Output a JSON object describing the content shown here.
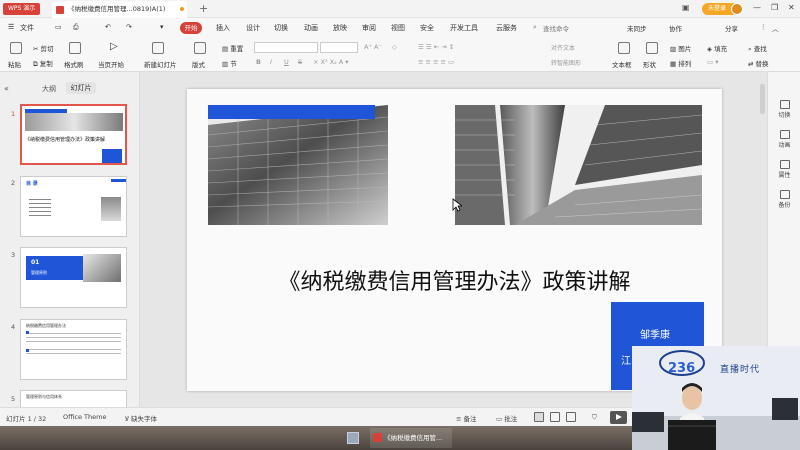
{
  "titlebar": {
    "app_name": "WPS 演示",
    "doc_tab_title": "《纳税缴费信用管理...0819)A(1)",
    "login_label": "未登录"
  },
  "menubar": {
    "file": "文件",
    "active_tab": "开始",
    "tabs": [
      "插入",
      "设计",
      "切换",
      "动画",
      "放映",
      "审阅",
      "视图",
      "安全",
      "开发工具",
      "云服务"
    ],
    "search": "查找命令",
    "sync": "未同步",
    "collab": "协作",
    "share": "分享"
  },
  "ribbon": {
    "paste": "粘贴",
    "cut": "剪切",
    "copy": "复制",
    "format_painter": "格式刷",
    "play_from_current": "当页开始",
    "new_slide": "新建幻灯片",
    "layout": "版式",
    "section": "节",
    "reset": "重置",
    "text_box": "文本框",
    "shape": "形状",
    "arrange": "排列",
    "picture": "图片",
    "fill": "填充",
    "find": "查找",
    "replace": "替换",
    "align_text": "对齐文本",
    "convert_smartart": "转智能图形",
    "font_bold": "B",
    "font_italic": "I",
    "font_underline": "U",
    "font_strike": "S"
  },
  "left_panel": {
    "tab_outline": "大纲",
    "tab_slides": "幻灯片",
    "slides": [
      {
        "num": "1",
        "title": "《纳税缴费信用管理办法》政策讲解"
      },
      {
        "num": "2",
        "title": "目 录"
      },
      {
        "num": "3",
        "title": "01",
        "subtitle": "管理原则"
      },
      {
        "num": "4",
        "title": "纳税缴费信用管理办法"
      },
      {
        "num": "5",
        "title": "管理原则与信用体系"
      }
    ]
  },
  "slide": {
    "title": "《纳税缴费信用管理办法》政策讲解",
    "presenter": "邹季康",
    "presenter_org": "江"
  },
  "right_sidebar": {
    "items": [
      "切换",
      "动画",
      "属性",
      "备份"
    ]
  },
  "statusbar": {
    "slide_info": "幻灯片 1 / 32",
    "theme": "Office Theme",
    "missing_font": "缺失字体",
    "notes": "备注",
    "comments": "批注"
  },
  "taskbar": {
    "app_title": "《纳税缴费信用管..."
  },
  "webcam": {
    "logo_text": "直播时代"
  },
  "colors": {
    "accent_red": "#d7413a",
    "slide_blue": "#1f55d6",
    "login_orange": "#f5a623"
  }
}
